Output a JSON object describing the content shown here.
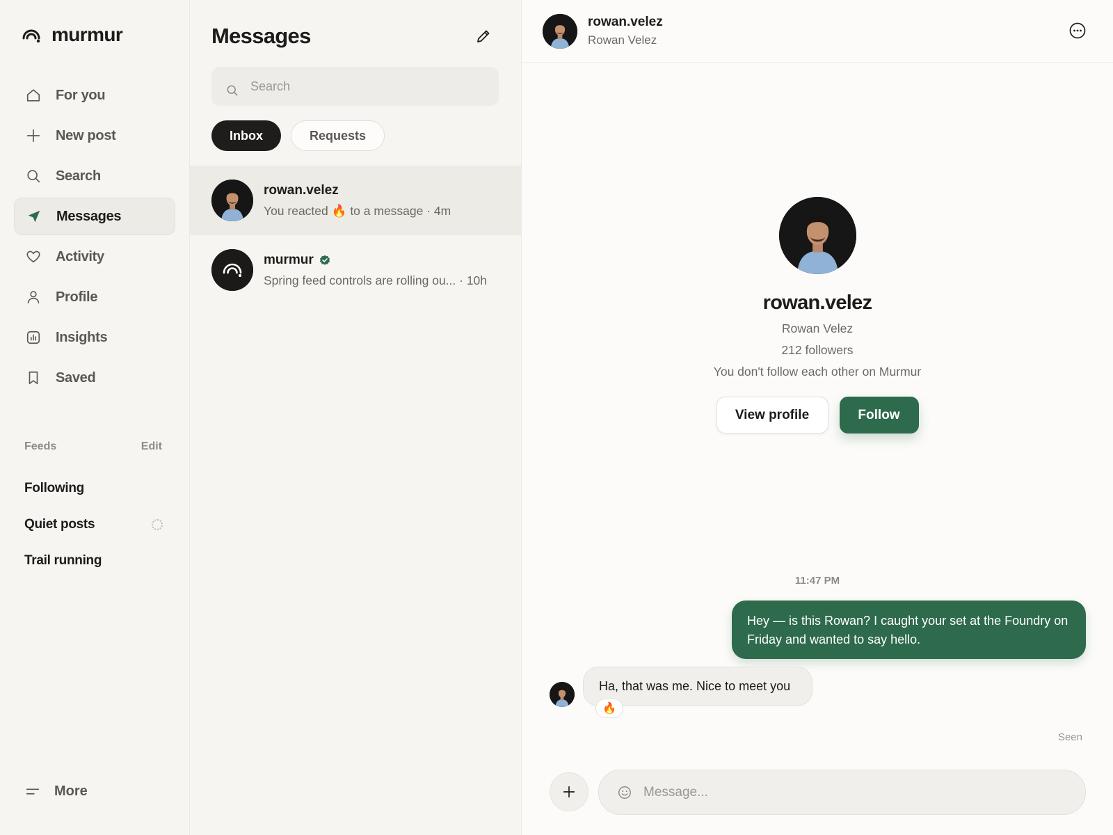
{
  "app": {
    "name": "murmur",
    "accent_color": "#2e6a4c"
  },
  "sidebar": {
    "nav": [
      {
        "label": "For you",
        "icon": "home-icon"
      },
      {
        "label": "New post",
        "icon": "plus-icon"
      },
      {
        "label": "Search",
        "icon": "search-icon"
      },
      {
        "label": "Messages",
        "icon": "send-icon",
        "active": true
      },
      {
        "label": "Activity",
        "icon": "heart-icon"
      },
      {
        "label": "Profile",
        "icon": "person-icon"
      },
      {
        "label": "Insights",
        "icon": "chart-icon"
      },
      {
        "label": "Saved",
        "icon": "bookmark-icon"
      }
    ],
    "feeds_header": "Feeds",
    "feeds_edit": "Edit",
    "feeds": [
      {
        "label": "Following"
      },
      {
        "label": "Quiet posts",
        "loading": true
      },
      {
        "label": "Trail running"
      }
    ],
    "more_label": "More"
  },
  "messages_panel": {
    "title": "Messages",
    "search_placeholder": "Search",
    "tabs": [
      {
        "label": "Inbox",
        "active": true
      },
      {
        "label": "Requests",
        "active": false
      }
    ],
    "conversations": [
      {
        "name": "rowan.velez",
        "preview_start": "You reacted",
        "preview_emoji": "🔥",
        "preview_end": "to a message · 4m",
        "selected": true
      },
      {
        "name": "murmur",
        "verified": true,
        "preview": "Spring feed controls are rolling ou... · 10h"
      }
    ]
  },
  "chat": {
    "header": {
      "username": "rowan.velez",
      "real_name": "Rowan Velez"
    },
    "profile": {
      "username": "rowan.velez",
      "real_name": "Rowan Velez",
      "followers": "212 followers",
      "relation": "You don't follow each other on Murmur",
      "view_profile_label": "View profile",
      "follow_label": "Follow"
    },
    "timestamp": "11:47 PM",
    "outgoing_message": "Hey — is this Rowan? I caught your set at the Foundry on Friday and wanted to say hello.",
    "incoming_message": "Ha, that was me. Nice to meet you",
    "reaction": "🔥",
    "seen_label": "Seen",
    "composer_placeholder": "Message..."
  }
}
